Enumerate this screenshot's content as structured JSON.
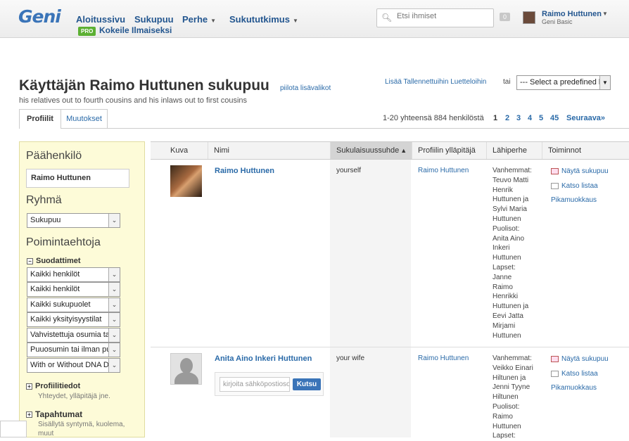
{
  "header": {
    "logo": "Geni",
    "nav": [
      {
        "label": "Aloitussivu",
        "caret": ""
      },
      {
        "label": "Sukupuu",
        "caret": ""
      },
      {
        "label": "Perhe",
        "caret": "▼"
      },
      {
        "label": "Sukututkimus",
        "caret": "▼"
      }
    ],
    "pro_badge": "PRO",
    "pro_text": "Kokeile Ilmaiseksi",
    "search_placeholder": "Etsi ihmiset",
    "notifications": "0",
    "user_name": "Raimo Huttunen",
    "user_plan": "Geni Basic"
  },
  "page": {
    "title": "Käyttäjän Raimo Huttunen sukupuu",
    "hide_link": "piilota lisävalikot",
    "subtitle": "his relatives out to fourth cousins and his inlaws out to first cousins",
    "add_link": "Lisää Tallennettuihin Luetteloihin",
    "or": "tai",
    "predefined": "--- Select a predefined l"
  },
  "tabs": [
    {
      "label": "Profiilit",
      "active": true
    },
    {
      "label": "Muutokset",
      "active": false
    }
  ],
  "pagination": {
    "count": "1-20 yhteensä 884 henkilöstä",
    "pages": [
      "1",
      "2",
      "3",
      "4",
      "5",
      "45"
    ],
    "next": "Seuraava»"
  },
  "sidebar": {
    "focus_heading": "Päähenkilö",
    "focus_value": "Raimo Huttunen",
    "group_heading": "Ryhmä",
    "group_value": "Sukupuu",
    "criteria_heading": "Poimintaehtoja",
    "filters_label": "Suodattimet",
    "filters": [
      "Kaikki henkilöt",
      "Kaikki henkilöt",
      "Kaikki sukupuolet",
      "Kaikki yksityisyystilat",
      "Vahvistettuja osumia tai",
      "Puuosumin tai ilman pu",
      "With or Without DNA D"
    ],
    "profile_info_label": "Profiilitiedot",
    "profile_info_desc": "Yhteydet, ylläpitäjä jne.",
    "events_label": "Tapahtumat",
    "events_desc_1": "Sisällytä syntymä, kuolema,",
    "events_desc_2": "muut"
  },
  "table": {
    "columns": [
      "Kuva",
      "Nimi",
      "Sukulaisuussuhde",
      "Profiilin ylläpitäjä",
      "Lähiperhe",
      "Toiminnot"
    ],
    "rows": [
      {
        "name": "Raimo Huttunen",
        "relation": "yourself",
        "manager": "Raimo Huttunen",
        "family": [
          "Vanhemmat:",
          "Teuvo Matti",
          "Henrik",
          "Huttunen ja",
          "Sylvi Maria",
          "Huttunen",
          "Puolisot:",
          "Anita Aino",
          "Inkeri",
          "Huttunen",
          "Lapset:",
          "Janne",
          "Raimo",
          "Henrikki",
          "Huttunen ja",
          "Eevi Jatta",
          "Mirjami",
          "Huttunen"
        ],
        "actions": [
          "Näytä sukupuu",
          "Katso listaa",
          "Pikamuokkaus"
        ]
      },
      {
        "name": "Anita Aino Inkeri Huttunen",
        "relation": "your wife",
        "manager": "Raimo Huttunen",
        "family": [
          "Vanhemmat:",
          "Veikko Einari",
          "Hiltunen ja",
          "Jenni Tyyne",
          "Hiltunen",
          "Puolisot:",
          "Raimo",
          "Huttunen",
          "Lapset:"
        ],
        "actions": [
          "Näytä sukupuu",
          "Katso listaa",
          "Pikamuokkaus"
        ],
        "invite_placeholder": "kirjoita sähköpostiosoite",
        "invite_button": "Kutsu"
      }
    ]
  },
  "colors": {
    "brand": "#3a74b8",
    "link": "#2a6aa8",
    "pro_green": "#5cb033",
    "sidebar_bg": "#fdfbd8"
  }
}
